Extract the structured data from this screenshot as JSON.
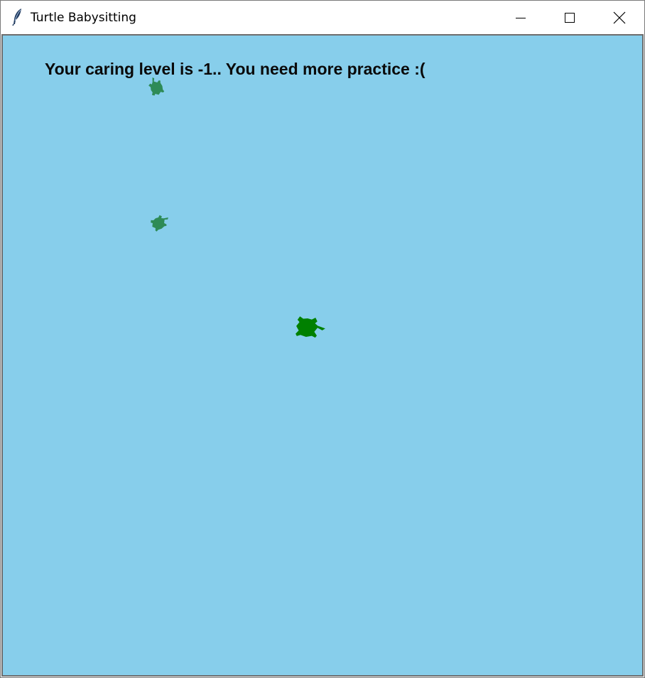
{
  "window": {
    "title": "Turtle Babysitting",
    "icon": "feather-icon",
    "controls": [
      "minimize-icon",
      "maximize-icon",
      "close-icon"
    ]
  },
  "canvas": {
    "background_color": "#87CEEB",
    "status_message": "Your caring level is -1..  You need more practice :(",
    "turtles": [
      {
        "role": "baby",
        "color": "#2E8B57",
        "icon": "turtle-icon"
      },
      {
        "role": "baby",
        "color": "#2E8B57",
        "icon": "turtle-icon"
      },
      {
        "role": "player",
        "color": "#008000",
        "icon": "turtle-icon"
      }
    ]
  }
}
